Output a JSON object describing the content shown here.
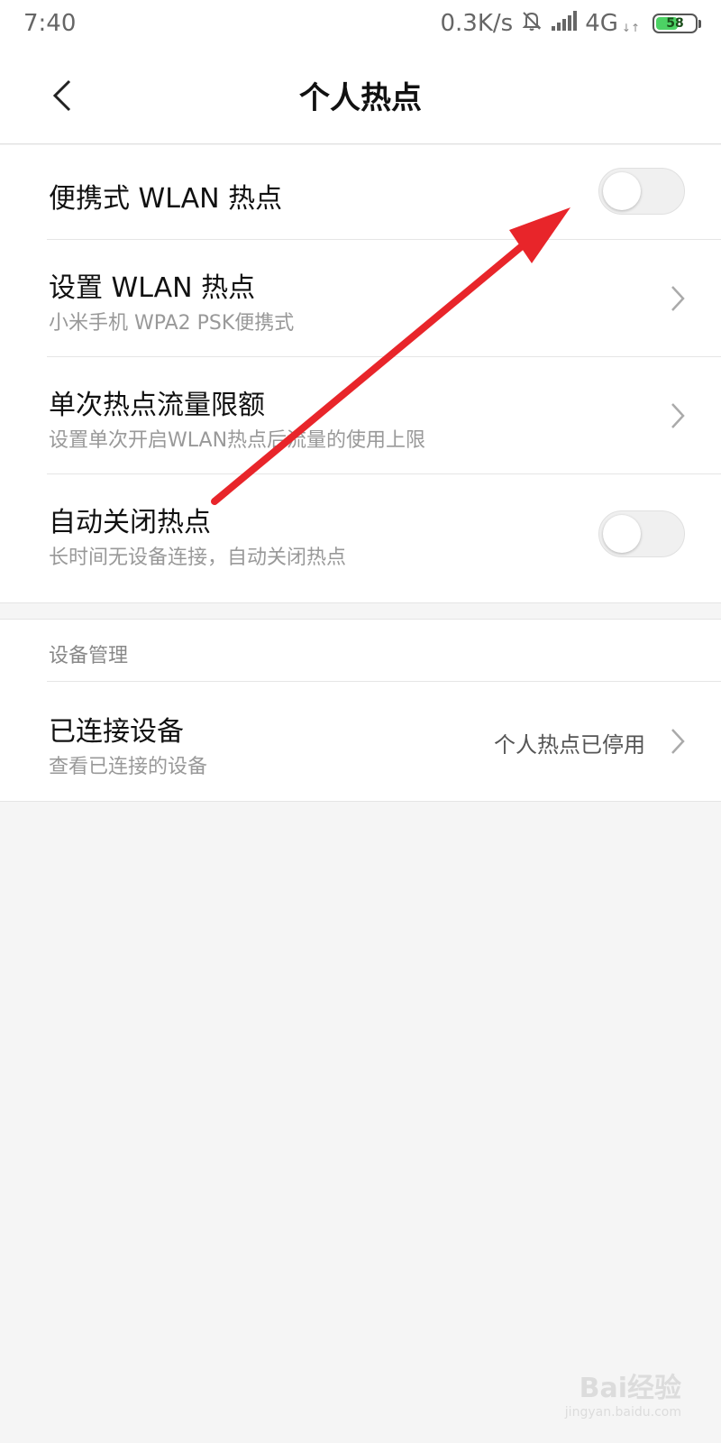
{
  "status_bar": {
    "time": "7:40",
    "speed": "0.3K/s",
    "network": "4G",
    "network_sub": "↓↑",
    "battery_level": "58",
    "battery_fraction": 0.58,
    "icons": [
      "bell-off-icon",
      "signal-icon",
      "battery-icon"
    ]
  },
  "header": {
    "title": "个人热点",
    "back_icon": "chevron-left-icon"
  },
  "settings": {
    "portable_hotspot": {
      "title": "便携式 WLAN 热点",
      "enabled": false
    },
    "setup_hotspot": {
      "title": "设置 WLAN 热点",
      "subtitle": "小米手机 WPA2 PSK便携式"
    },
    "data_limit": {
      "title": "单次热点流量限额",
      "subtitle": "设置单次开启WLAN热点后流量的使用上限"
    },
    "auto_close": {
      "title": "自动关闭热点",
      "subtitle": "长时间无设备连接，自动关闭热点",
      "enabled": false
    }
  },
  "device_management": {
    "label": "设备管理",
    "connected_devices": {
      "title": "已连接设备",
      "subtitle": "查看已连接的设备",
      "value": "个人热点已停用"
    }
  },
  "annotation": {
    "color": "#e8252a"
  },
  "watermark": {
    "main": "Bai经验",
    "sub": "jingyan.baidu.com"
  },
  "colors": {
    "background": "#f5f5f5",
    "surface": "#ffffff",
    "toggle_off": "#f0f0f0"
  }
}
